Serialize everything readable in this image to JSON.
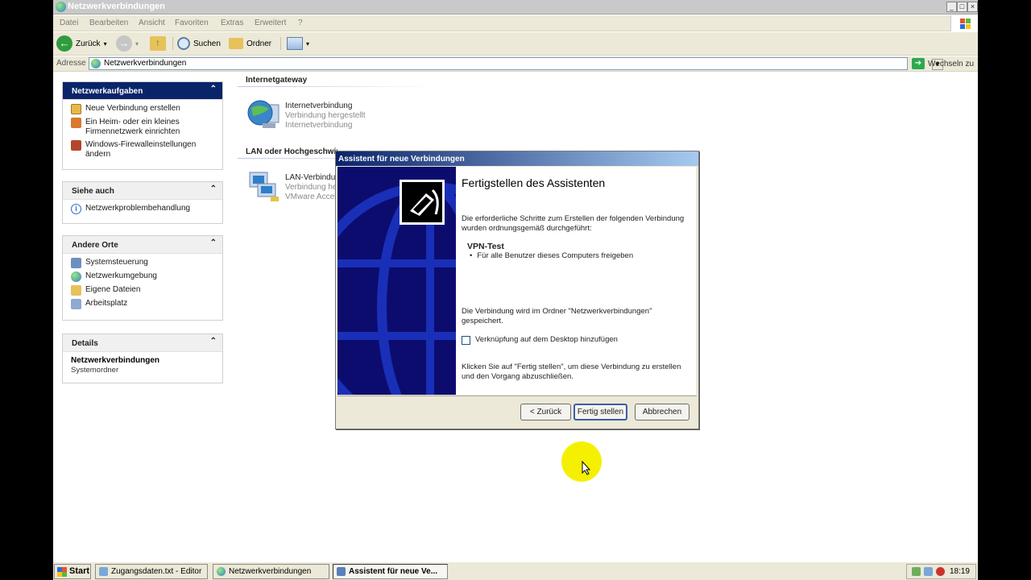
{
  "window": {
    "title": "Netzwerkverbindungen",
    "controls": [
      "_",
      "□",
      "×"
    ]
  },
  "menu": [
    "Datei",
    "Bearbeiten",
    "Ansicht",
    "Favoriten",
    "Extras",
    "Erweitert",
    "?"
  ],
  "toolbar": {
    "back": "Zurück",
    "search": "Suchen",
    "folders": "Ordner"
  },
  "address": {
    "label": "Adresse",
    "value": "Netzwerkverbindungen",
    "go": "Wechseln zu"
  },
  "sidebar": {
    "tasks": {
      "title": "Netzwerkaufgaben",
      "items": [
        {
          "label": "Neue Verbindung erstellen",
          "icon": "new-connection-icon"
        },
        {
          "label": "Ein Heim- oder ein kleines Firmennetzwerk einrichten",
          "icon": "home-network-icon"
        },
        {
          "label": "Windows-Firewalleinstellungen ändern",
          "icon": "firewall-icon"
        }
      ]
    },
    "see_also": {
      "title": "Siehe auch",
      "items": [
        {
          "label": "Netzwerkproblembehandlung",
          "icon": "info-icon"
        }
      ]
    },
    "other_places": {
      "title": "Andere Orte",
      "items": [
        {
          "label": "Systemsteuerung",
          "icon": "control-panel-icon"
        },
        {
          "label": "Netzwerkumgebung",
          "icon": "network-places-icon"
        },
        {
          "label": "Eigene Dateien",
          "icon": "my-documents-icon"
        },
        {
          "label": "Arbeitsplatz",
          "icon": "my-computer-icon"
        }
      ]
    },
    "details": {
      "title": "Details",
      "name": "Netzwerkverbindungen",
      "type": "Systemordner"
    }
  },
  "main": {
    "groups": [
      {
        "title": "Internetgateway",
        "item": {
          "name": "Internetverbindung",
          "status": "Verbindung hergestellt",
          "type": "Internetverbindung"
        }
      },
      {
        "title": "LAN oder Hochgeschwindigkeitsinternet",
        "item": {
          "name": "LAN-Verbindung",
          "status": "Verbindung hergestellt",
          "type": "VMware Accelerated AMD PCNet Adapter"
        }
      }
    ]
  },
  "dialog": {
    "title": "Assistent für neue Verbindungen",
    "heading": "Fertigstellen des Assistenten",
    "intro": "Die erforderliche Schritte zum Erstellen der folgenden Verbindung wurden ordnungsgemäß durchgeführt:",
    "conn_name": "VPN-Test",
    "conn_detail": "Für alle Benutzer dieses Computers freigeben",
    "saved_note": "Die Verbindung wird im Ordner \"Netzwerkverbindungen\" gespeichert.",
    "checkbox_label": "Verknüpfung auf dem Desktop hinzufügen",
    "checkbox_checked": false,
    "finish_note": "Klicken Sie auf \"Fertig stellen\", um diese Verbindung zu erstellen und den Vorgang abzuschließen.",
    "buttons": {
      "back": "< Zurück",
      "finish": "Fertig stellen",
      "cancel": "Abbrechen"
    }
  },
  "taskbar": {
    "start": "Start",
    "tasks": [
      {
        "label": "Zugangsdaten.txt - Editor",
        "active": false
      },
      {
        "label": "Netzwerkverbindungen",
        "active": false
      },
      {
        "label": "Assistent für neue Ve...",
        "active": true
      }
    ],
    "clock": "18:19"
  }
}
